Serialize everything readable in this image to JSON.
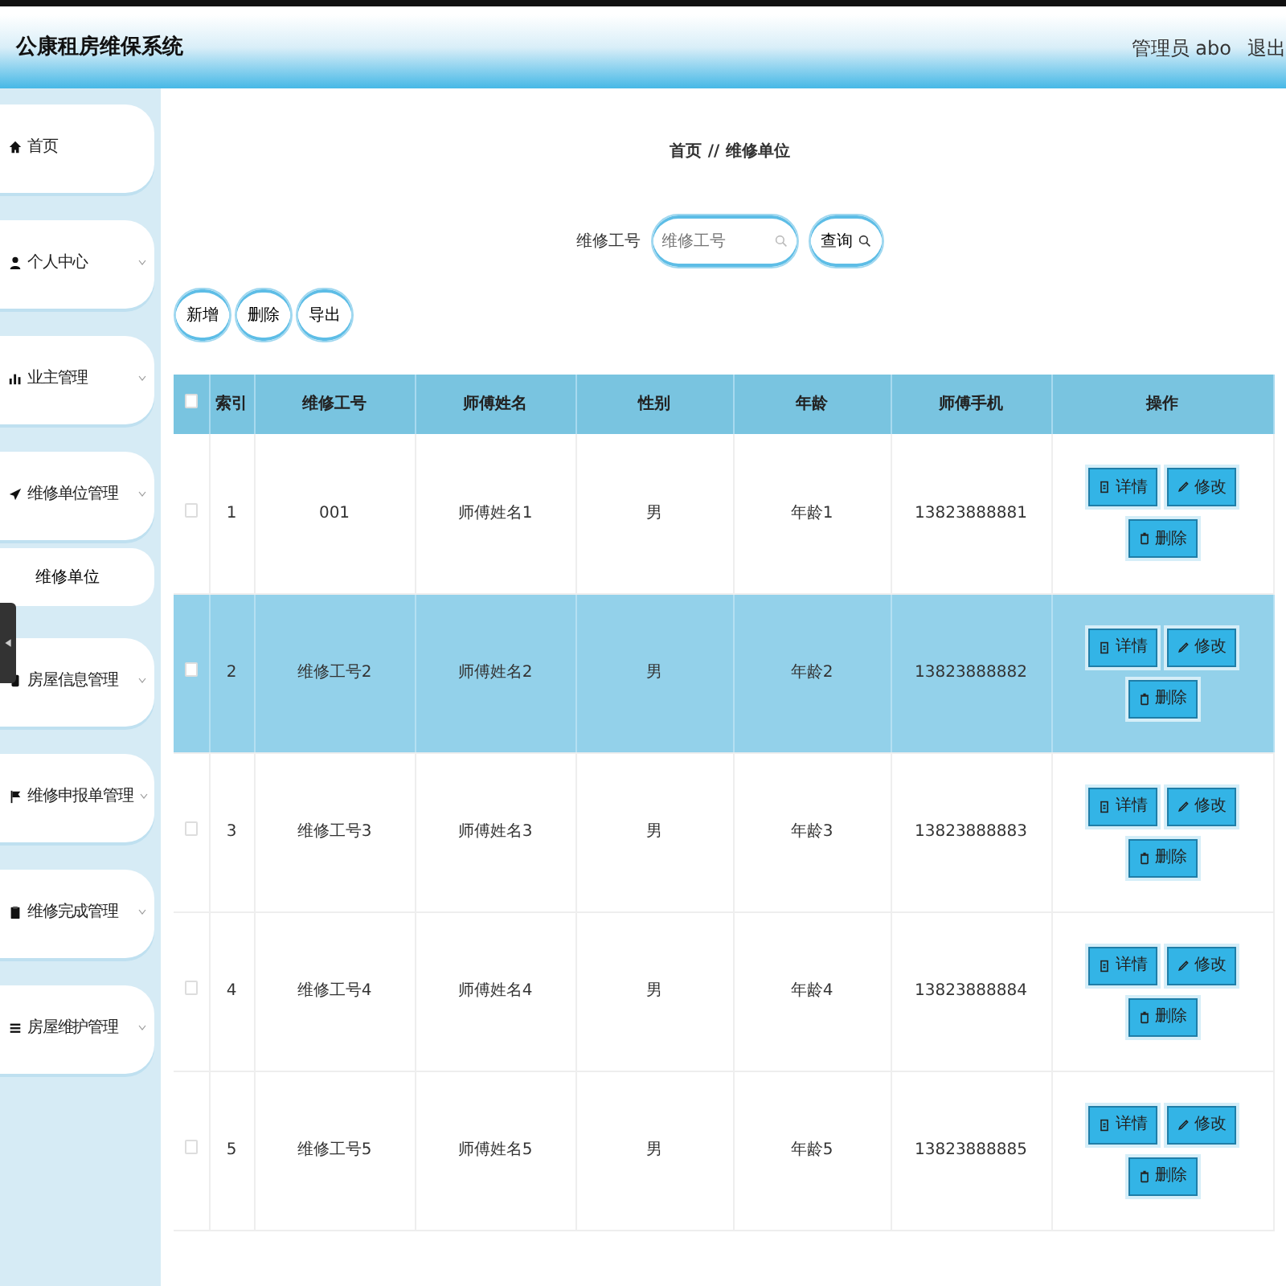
{
  "header": {
    "title": "公康租房维保系统",
    "user": "管理员 abo",
    "logout": "退出"
  },
  "sidebar": {
    "items": [
      {
        "label": "首页",
        "expandable": false
      },
      {
        "label": "个人中心",
        "expandable": true
      },
      {
        "label": "业主管理",
        "expandable": true
      },
      {
        "label": "维修单位管理",
        "expandable": true,
        "children": [
          {
            "label": "维修单位"
          }
        ]
      },
      {
        "label": "房屋信息管理",
        "expandable": true
      },
      {
        "label": "维修申报单管理",
        "expandable": true
      },
      {
        "label": "维修完成管理",
        "expandable": true
      },
      {
        "label": "房屋维护管理",
        "expandable": true
      }
    ]
  },
  "breadcrumb": [
    "首页",
    "//",
    "维修单位"
  ],
  "search": {
    "label": "维修工号",
    "placeholder": "维修工号",
    "button": "查询"
  },
  "toolbar": [
    "新增",
    "删除",
    "导出"
  ],
  "table": {
    "select_all_checked": false,
    "columns": [
      "索引",
      "维修工号",
      "师傅姓名",
      "性别",
      "年龄",
      "师傅手机",
      "操作"
    ],
    "rows": [
      {
        "checked": false,
        "selected": false,
        "cells": [
          "1",
          "001",
          "师傅姓名1",
          "男",
          "年龄1",
          "13823888881"
        ],
        "actions": [
          "详情",
          "修改",
          "删除"
        ]
      },
      {
        "checked": false,
        "selected": true,
        "cells": [
          "2",
          "维修工号2",
          "师傅姓名2",
          "男",
          "年龄2",
          "13823888882"
        ],
        "actions": [
          "详情",
          "修改",
          "删除"
        ]
      },
      {
        "checked": false,
        "selected": false,
        "cells": [
          "3",
          "维修工号3",
          "师傅姓名3",
          "男",
          "年龄3",
          "13823888883"
        ],
        "actions": [
          "详情",
          "修改",
          "删除"
        ]
      },
      {
        "checked": false,
        "selected": false,
        "cells": [
          "4",
          "维修工号4",
          "师傅姓名4",
          "男",
          "年龄4",
          "13823888884"
        ],
        "actions": [
          "详情",
          "修改",
          "删除"
        ]
      },
      {
        "checked": false,
        "selected": false,
        "cells": [
          "5",
          "维修工号5",
          "师傅姓名5",
          "男",
          "年龄5",
          "13823888885"
        ],
        "actions": [
          "详情",
          "修改",
          "删除"
        ]
      }
    ]
  }
}
